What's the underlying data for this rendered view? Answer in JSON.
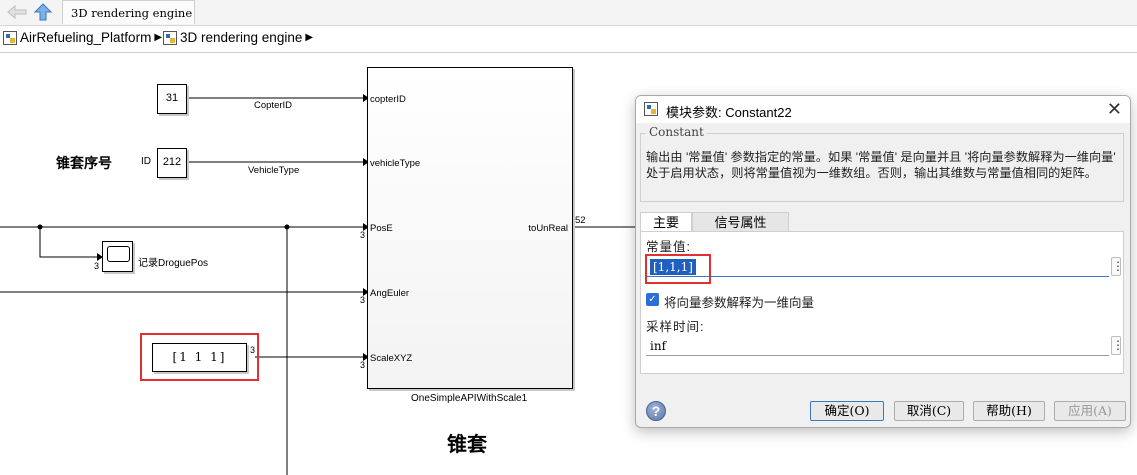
{
  "toolbar": {
    "tab_label": "3D rendering engine"
  },
  "breadcrumb": {
    "items": [
      "AirRefueling_Platform",
      "3D rendering engine"
    ]
  },
  "canvas": {
    "const_31": "31",
    "const_212": "212",
    "const_111": "[1 1 1]",
    "label_copterid": "CopterID",
    "label_vehicletype": "VehicleType",
    "heading_seq": "锥套序号",
    "id_label": "ID",
    "scope_label": "记录DroguePos",
    "port_in": [
      "copterID",
      "vehicleType",
      "PosE",
      "AngEuler",
      "ScaleXYZ"
    ],
    "port_out": "toUnReal",
    "subsys_name": "OneSimpleAPIWithScale1",
    "out_width": "52",
    "dim_3": "3",
    "big_title": "锥套"
  },
  "dialog": {
    "title": "模块参数: Constant22",
    "group": "Constant",
    "description": "输出由 '常量值' 参数指定的常量。如果 '常量值' 是向量并且 '将向量参数解释为一维向量' 处于启用状态，则将常量值视为一维数组。否则，输出其维数与常量值相同的矩阵。",
    "tabs": [
      "主要",
      "信号属性"
    ],
    "const_label": "常量值:",
    "const_value": "[1,1,1]",
    "checkbox_label": "将向量参数解释为一维向量",
    "sample_label": "采样时间:",
    "sample_value": "inf",
    "buttons": [
      "确定(O)",
      "取消(C)",
      "帮助(H)",
      "应用(A)"
    ]
  }
}
